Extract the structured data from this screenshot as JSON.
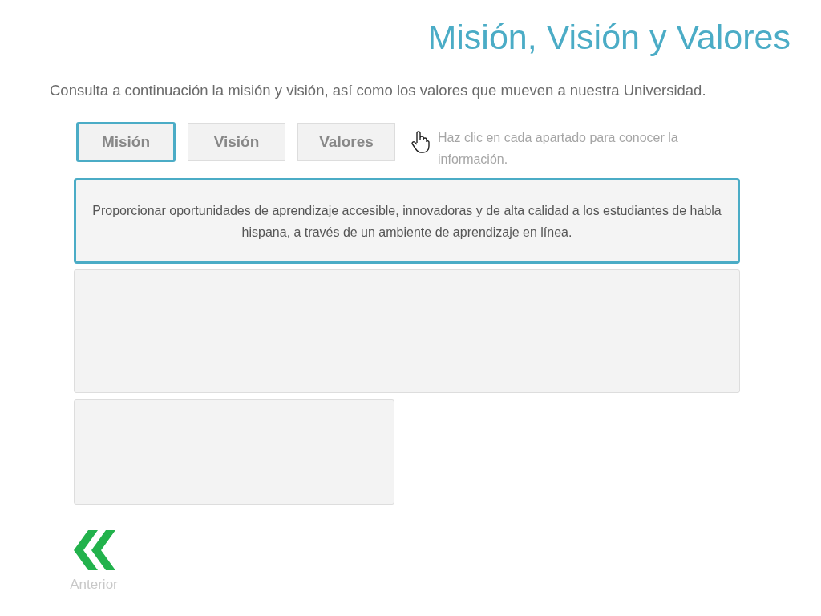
{
  "title": "Misión, Visión y Valores",
  "intro": "Consulta a continuación la misión y visión, así como los valores que mueven a nuestra Universidad.",
  "tabs": [
    {
      "label": "Misión",
      "selected": true
    },
    {
      "label": "Visión",
      "selected": false
    },
    {
      "label": "Valores",
      "selected": false
    }
  ],
  "hint": "Haz clic en cada  apartado para conocer la información.",
  "content": "Proporcionar oportunidades de aprendizaje accesible, innovadoras y de alta calidad a los estudiantes de habla hispana, a través de un ambiente de aprendizaje en línea.",
  "nav": {
    "label": "Anterior"
  }
}
